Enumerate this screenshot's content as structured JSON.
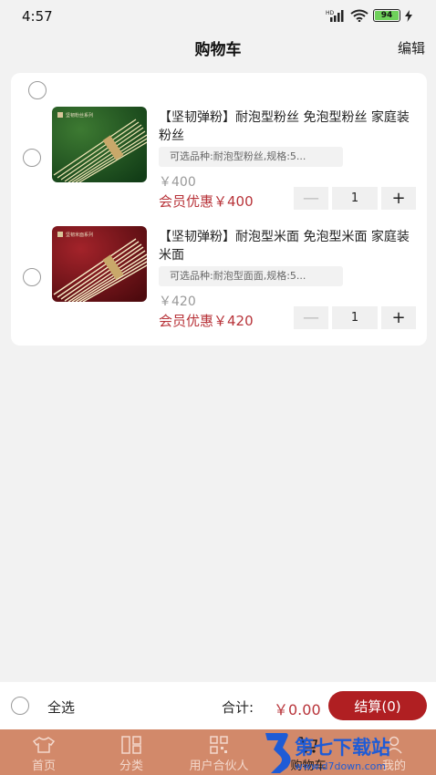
{
  "status_bar": {
    "time": "4:57",
    "battery": "94"
  },
  "header": {
    "title": "购物车",
    "edit_label": "编辑"
  },
  "cart": {
    "items": [
      {
        "name": "【坚韧弹粉】耐泡型粉丝 免泡型粉丝 家庭装粉丝",
        "spec": "可选品种:耐泡型粉丝,规格:5...",
        "original_price": "￥400",
        "member_price": "会员优惠￥400",
        "quantity": "1",
        "image_label": "坚韧粉丝系列",
        "image_bg": "#1f5a23"
      },
      {
        "name": "【坚韧弹粉】耐泡型米面 免泡型米面 家庭装米面",
        "spec": "可选品种:耐泡型面面,规格:5...",
        "original_price": "￥420",
        "member_price": "会员优惠￥420",
        "quantity": "1",
        "image_label": "坚韧米面系列",
        "image_bg": "#7d1318"
      }
    ],
    "minus_symbol": "—",
    "plus_symbol": "+"
  },
  "footer": {
    "select_all": "全选",
    "total_label": "合计:",
    "total_value": "￥0.00",
    "checkout": "结算(0)"
  },
  "tabs": [
    {
      "label": "首页",
      "icon": "shirt-icon"
    },
    {
      "label": "分类",
      "icon": "grid-icon"
    },
    {
      "label": "用户合伙人",
      "icon": "qrcode-icon"
    },
    {
      "label": "购物车",
      "icon": "cart-icon",
      "active": true
    },
    {
      "label": "我的",
      "icon": "user-icon"
    }
  ],
  "watermark": {
    "text": "第七下载站",
    "url": "www.d7down.com"
  },
  "colors": {
    "accent": "#b01f22",
    "price": "#b8343a",
    "tabbar": "#d2896a"
  }
}
